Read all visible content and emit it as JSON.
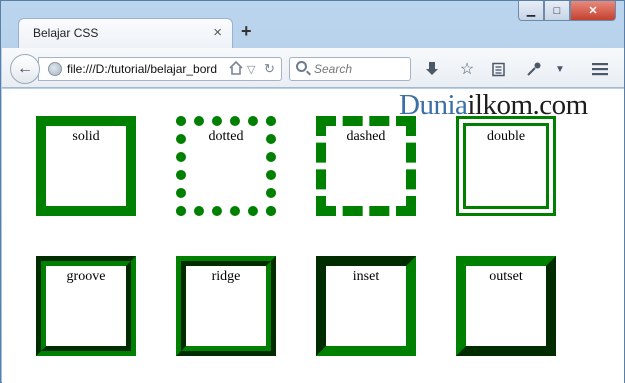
{
  "browser": {
    "tab_title": "Belajar CSS",
    "tab_close": "×",
    "new_tab": "+",
    "url": "file:///D:/tutorial/belajar_bord",
    "search_placeholder": "Search",
    "window_controls": {
      "minimize": "▁",
      "maximize": "□",
      "close": "✕"
    },
    "icons": [
      "back-arrow-icon",
      "globe-icon",
      "home-icon",
      "dropdown-icon",
      "reload-icon",
      "search-icon",
      "download-icon",
      "bookmark-star-icon",
      "reading-list-icon",
      "eyedropper-icon",
      "chevron-down-icon",
      "menu-icon"
    ]
  },
  "page": {
    "brand_part1": "Dunia",
    "brand_part2": "ilkom.com",
    "brand_colors": {
      "part1": "#3a6fa8",
      "part2": "#1d1d1d"
    },
    "border_color": "#008000",
    "boxes": [
      {
        "label": "solid"
      },
      {
        "label": "dotted"
      },
      {
        "label": "dashed"
      },
      {
        "label": "double"
      },
      {
        "label": "groove"
      },
      {
        "label": "ridge"
      },
      {
        "label": "inset"
      },
      {
        "label": "outset"
      }
    ]
  }
}
